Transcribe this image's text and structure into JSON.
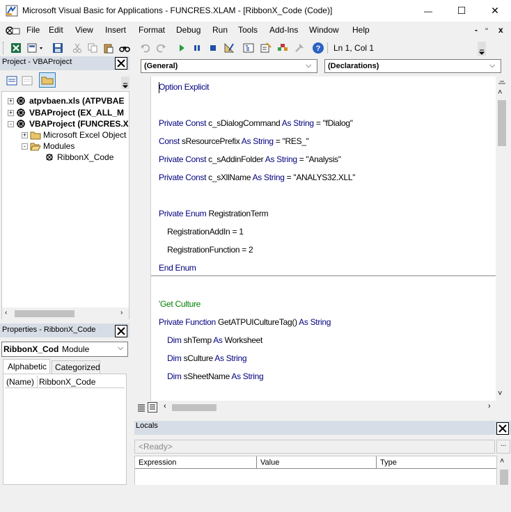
{
  "window": {
    "title": "Microsoft Visual Basic for Applications - FUNCRES.XLAM - [RibbonX_Code (Code)]",
    "minimize_glyph": "—",
    "maximize_glyph": "☐",
    "close_glyph": "✕"
  },
  "menu": {
    "items": [
      "File",
      "Edit",
      "View",
      "Insert",
      "Format",
      "Debug",
      "Run",
      "Tools",
      "Add-Ins",
      "Window",
      "Help"
    ],
    "mdi_minimize": "-",
    "mdi_restore": "▫",
    "mdi_close": "x"
  },
  "toolbar": {
    "position": "Ln 1, Col 1"
  },
  "project": {
    "title": "Project - VBAProject",
    "nodes": [
      {
        "label": "atpvbaen.xls (ATPVBAE",
        "level": 0,
        "expander": "+",
        "icon": "vbaproject-icon"
      },
      {
        "label": "VBAProject (EX_ALL_M",
        "level": 0,
        "expander": "+",
        "icon": "vbaproject-icon"
      },
      {
        "label": "VBAProject (FUNCRES.X",
        "level": 0,
        "expander": "-",
        "icon": "vbaproject-icon"
      },
      {
        "label": "Microsoft Excel Object",
        "level": 1,
        "expander": "+",
        "icon": "folder-icon"
      },
      {
        "label": "Modules",
        "level": 1,
        "expander": "-",
        "icon": "folder-open-icon"
      },
      {
        "label": "RibbonX_Code",
        "level": 2,
        "expander": "",
        "icon": "module-icon"
      }
    ]
  },
  "properties": {
    "title": "Properties - RibbonX_Code",
    "object_name": "RibbonX_Cod",
    "object_type": "Module",
    "tabs": [
      "Alphabetic",
      "Categorized"
    ],
    "rows": [
      {
        "name": "(Name)",
        "value": "RibbonX_Code"
      }
    ]
  },
  "code": {
    "object_combo": "(General)",
    "proc_combo": "(Declarations)",
    "lines": [
      {
        "segments": [
          {
            "t": "Option Explicit",
            "c": "kw"
          }
        ]
      },
      {
        "segments": []
      },
      {
        "segments": [
          {
            "t": "Private Const ",
            "c": "kw"
          },
          {
            "t": "c_sDialogCommand ",
            "c": ""
          },
          {
            "t": "As String",
            "c": "kw"
          },
          {
            "t": " = \"fDialog\"",
            "c": ""
          }
        ]
      },
      {
        "segments": [
          {
            "t": "Const ",
            "c": "kw"
          },
          {
            "t": "sResourcePrefix ",
            "c": ""
          },
          {
            "t": "As String",
            "c": "kw"
          },
          {
            "t": " = \"RES_\"",
            "c": ""
          }
        ]
      },
      {
        "segments": [
          {
            "t": "Private Const ",
            "c": "kw"
          },
          {
            "t": "c_sAddinFolder ",
            "c": ""
          },
          {
            "t": "As String",
            "c": "kw"
          },
          {
            "t": " = \"Analysis\"",
            "c": ""
          }
        ]
      },
      {
        "segments": [
          {
            "t": "Private Const ",
            "c": "kw"
          },
          {
            "t": "c_sXllName ",
            "c": ""
          },
          {
            "t": "As String",
            "c": "kw"
          },
          {
            "t": " = \"ANALYS32.XLL\"",
            "c": ""
          }
        ]
      },
      {
        "segments": []
      },
      {
        "segments": [
          {
            "t": "Private Enum ",
            "c": "kw"
          },
          {
            "t": "RegistrationTerm",
            "c": ""
          }
        ]
      },
      {
        "segments": [
          {
            "t": "    RegistrationAddIn = 1",
            "c": ""
          }
        ]
      },
      {
        "segments": [
          {
            "t": "    RegistrationFunction = 2",
            "c": ""
          }
        ]
      },
      {
        "segments": [
          {
            "t": "End Enum",
            "c": "kw"
          }
        ]
      },
      {
        "segments": [],
        "separator": true
      },
      {
        "segments": [
          {
            "t": "'Get Culture",
            "c": "cm"
          }
        ]
      },
      {
        "segments": [
          {
            "t": "Private Function ",
            "c": "kw"
          },
          {
            "t": "GetATPUICultureTag() ",
            "c": ""
          },
          {
            "t": "As String",
            "c": "kw"
          }
        ]
      },
      {
        "segments": [
          {
            "t": "    Dim ",
            "c": "kw"
          },
          {
            "t": "shTemp ",
            "c": ""
          },
          {
            "t": "As ",
            "c": "kw"
          },
          {
            "t": "Worksheet",
            "c": ""
          }
        ]
      },
      {
        "segments": [
          {
            "t": "    Dim ",
            "c": "kw"
          },
          {
            "t": "sCulture ",
            "c": ""
          },
          {
            "t": "As String",
            "c": "kw"
          }
        ]
      },
      {
        "segments": [
          {
            "t": "    Dim ",
            "c": "kw"
          },
          {
            "t": "sSheetName ",
            "c": ""
          },
          {
            "t": "As String",
            "c": "kw"
          }
        ]
      }
    ]
  },
  "locals": {
    "title": "Locals",
    "status": "<Ready>",
    "columns": [
      "Expression",
      "Value",
      "Type"
    ]
  },
  "colors": {
    "keyword": "#00007f",
    "comment": "#007f00",
    "panel_header": "#d7dde6"
  }
}
